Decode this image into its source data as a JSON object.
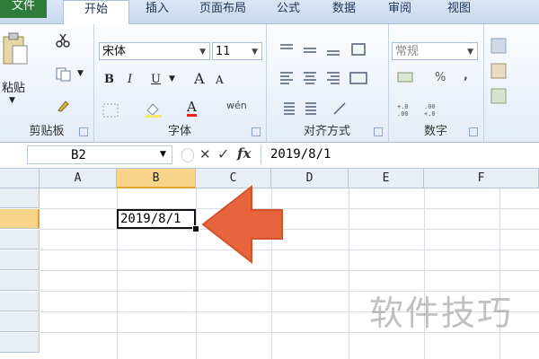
{
  "tabs": [
    {
      "label": "文件"
    },
    {
      "label": "开始"
    },
    {
      "label": "插入"
    },
    {
      "label": "页面布局"
    },
    {
      "label": "公式"
    },
    {
      "label": "数据"
    },
    {
      "label": "审阅"
    },
    {
      "label": "视图"
    }
  ],
  "ribbon": {
    "clipboard": {
      "label": "剪贴板",
      "paste_label": "粘贴"
    },
    "font": {
      "label": "字体",
      "font_name": "宋体",
      "font_size": "11",
      "bold": "B",
      "italic": "I",
      "underline": "U",
      "grow": "A",
      "shrink": "A",
      "color": "A",
      "phonetic": "wén"
    },
    "alignment": {
      "label": "对齐方式"
    },
    "number": {
      "label": "数字",
      "format": "常规",
      "percent": "%",
      "comma": ","
    }
  },
  "formula_bar": {
    "name_box": "B2",
    "cancel": "✕",
    "enter": "✓",
    "fx": "fx",
    "value": "2019/8/1"
  },
  "sheet": {
    "columns": [
      "A",
      "B",
      "C",
      "D",
      "E",
      "F"
    ],
    "selected_column": "B",
    "active_cell_value": "2019/8/1"
  },
  "watermark": "软件技巧",
  "colors": {
    "accent": "#f7d48a",
    "arrow": "#e8643c",
    "file_tab": "#2f7d3a"
  }
}
